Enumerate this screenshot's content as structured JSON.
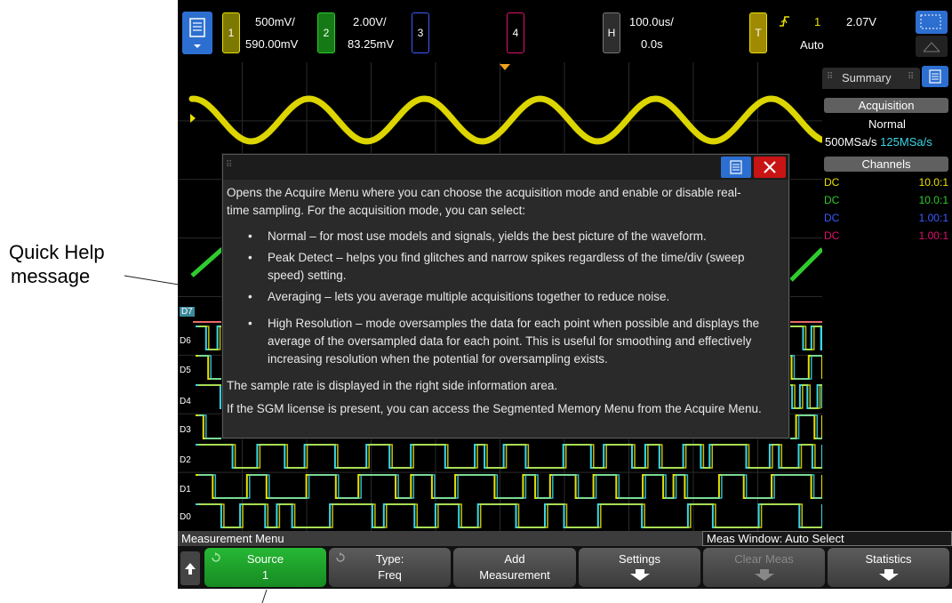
{
  "annotations": {
    "quick_help_line1": "Quick Help",
    "quick_help_line2": "message"
  },
  "topbar": {
    "channels": [
      {
        "num": "1",
        "scale": "500mV/",
        "offset": "590.00mV",
        "color": "#e8e000"
      },
      {
        "num": "2",
        "scale": "2.00V/",
        "offset": "83.25mV",
        "color": "#2ecc2e"
      },
      {
        "num": "3",
        "color": "#3a5cff"
      },
      {
        "num": "4",
        "color": "#e0106e"
      }
    ],
    "horizontal": {
      "badge": "H",
      "scale": "100.0us/",
      "delay": "0.0s"
    },
    "trigger": {
      "badge": "T",
      "source": "1",
      "level": "2.07V",
      "mode": "Auto"
    }
  },
  "right_panel": {
    "tab_label": "Summary",
    "acquisition_header": "Acquisition",
    "acq_mode": "Normal",
    "sample_rate_a": "500MSa/s",
    "sample_rate_b": "125MSa/s",
    "channels_header": "Channels",
    "channel_rows": [
      {
        "coupling": "DC",
        "probe": "10.0:1",
        "color": "#e8e000"
      },
      {
        "coupling": "DC",
        "probe": "10.0:1",
        "color": "#2ecc2e"
      },
      {
        "coupling": "DC",
        "probe": "1.00:1",
        "color": "#3a5cff"
      },
      {
        "coupling": "DC",
        "probe": "1.00:1",
        "color": "#e0106e"
      }
    ]
  },
  "quick_help": {
    "intro": "Opens the Acquire Menu where you can choose the acquisition mode and enable or disable real-time sampling. For the acquisition mode, you can select:",
    "bullets": [
      "Normal – for most use models and signals, yields the best picture of the waveform.",
      "Peak Detect – helps you find glitches and narrow spikes regardless of the time/div (sweep speed) setting.",
      "Averaging – lets you average multiple acquisitions together to reduce noise.",
      "High Resolution – mode oversamples the data for each point when possible and displays the average of the oversampled data for each point. This is useful for smoothing and effectively increasing resolution when the potential for oversampling exists."
    ],
    "sample_rate_note": "The sample rate is displayed in the right side information area.",
    "sgm_note": "If the SGM license is present, you can access the Segmented Memory Menu from the Acquire Menu."
  },
  "digital_labels": [
    "D7",
    "D6",
    "D5",
    "D4",
    "D3",
    "D2",
    "D1",
    "D0"
  ],
  "menu": {
    "title": "Measurement Menu",
    "meas_window": "Meas Window: Auto Select"
  },
  "softkeys": [
    {
      "line1": "Source",
      "line2": "1"
    },
    {
      "line1": "Type:",
      "line2": "Freq"
    },
    {
      "line1": "Add",
      "line2": "Measurement"
    },
    {
      "line1": "Settings",
      "line2": ""
    },
    {
      "line1": "Clear Meas",
      "line2": ""
    },
    {
      "line1": "Statistics",
      "line2": ""
    }
  ],
  "colors": {
    "ch1": "#e8e000",
    "digital": "#3ad7e8",
    "menu_blue": "#2d6fd0",
    "softkey_green": "#1ea52b",
    "close_red": "#c81414"
  }
}
